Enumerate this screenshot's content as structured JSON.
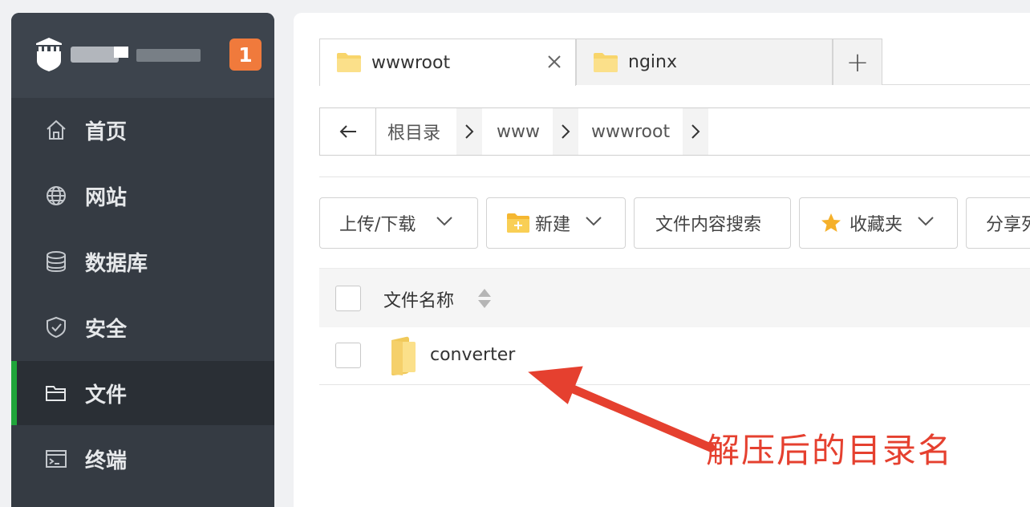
{
  "sidebar": {
    "badge": "1",
    "items": [
      {
        "label": "首页",
        "icon": "home-icon"
      },
      {
        "label": "网站",
        "icon": "globe-icon"
      },
      {
        "label": "数据库",
        "icon": "database-icon"
      },
      {
        "label": "安全",
        "icon": "shield-icon"
      },
      {
        "label": "文件",
        "icon": "folder-icon",
        "active": true
      },
      {
        "label": "终端",
        "icon": "terminal-icon"
      }
    ]
  },
  "tabs": [
    {
      "label": "wwwroot",
      "icon": "folder-icon",
      "active": true
    },
    {
      "label": "nginx",
      "icon": "folder-icon",
      "active": false
    }
  ],
  "tab_add": "+",
  "breadcrumb": {
    "items": [
      "根目录",
      "www",
      "wwwroot"
    ]
  },
  "toolbar": {
    "upload_download": "上传/下载",
    "new": "新建",
    "content_search": "文件内容搜索",
    "favorites": "收藏夹",
    "share": "分享列表"
  },
  "table": {
    "header_name": "文件名称",
    "rows": [
      {
        "name": "converter",
        "icon": "folder-icon"
      }
    ]
  },
  "annotation": {
    "text": "解压后的目录名"
  },
  "colors": {
    "sidebar_bg": "#353b43",
    "active_accent": "#20a53a",
    "badge": "#f07a3c",
    "annotation": "#e5402f",
    "folder": "#f8d56b"
  }
}
